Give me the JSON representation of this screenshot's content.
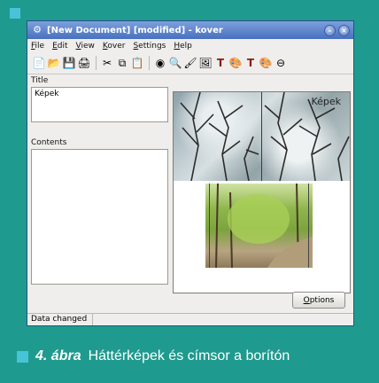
{
  "window": {
    "title": "[New Document] [modified] - kover",
    "controls": [
      "–",
      "×"
    ]
  },
  "menu": {
    "items": [
      "File",
      "Edit",
      "View",
      "Kover",
      "Settings",
      "Help"
    ]
  },
  "panel": {
    "title_label": "Title",
    "title_value": "Képek",
    "contents_label": "Contents",
    "contents_value": ""
  },
  "preview": {
    "cover_title": "Képek"
  },
  "buttons": {
    "options_label": "Options"
  },
  "status": {
    "text": "Data changed"
  },
  "caption": {
    "number": "4. ábra",
    "text": "Háttérképek és címsor a borítón"
  },
  "colors": {
    "background": "#1f9a8e",
    "accent": "#49c3d8",
    "titlebar": "#4770bf"
  }
}
